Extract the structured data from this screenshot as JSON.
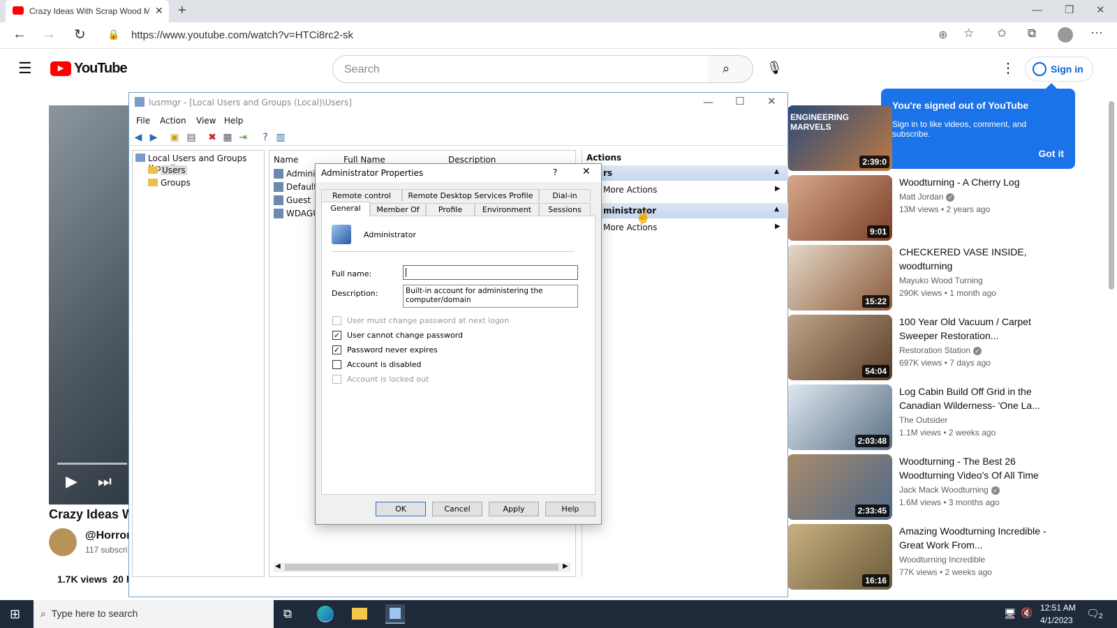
{
  "browser": {
    "tab_title": "Crazy Ideas With Scrap Wood M",
    "url": "https://www.youtube.com/watch?v=HTCi8rc2-sk"
  },
  "youtube": {
    "logo_text": "YouTube",
    "search_placeholder": "Search",
    "sign_in": "Sign in",
    "video_title_partial": "Crazy Ideas W",
    "channel_handle": "@Horror",
    "subscribers": "117 subscri",
    "views": "1.7K views",
    "age": "20 ho",
    "popup": {
      "title": "You're signed out of YouTube",
      "body": "Sign in to like videos, comment, and subscribe.",
      "button": "Got it"
    },
    "recommendations": [
      {
        "thumb_text": "ENGINEERING MARVELS",
        "duration": "2:39:0",
        "title": "",
        "channel": "",
        "meta": ""
      },
      {
        "duration": "9:01",
        "title": "Woodturning - A Cherry Log",
        "channel": "Matt Jordan",
        "verified": true,
        "meta": "13M views • 2 years ago"
      },
      {
        "duration": "15:22",
        "title": "CHECKERED VASE INSIDE, woodturning",
        "channel": "Mayuko Wood Turning",
        "verified": false,
        "meta": "290K views • 1 month ago"
      },
      {
        "duration": "54:04",
        "title": "100 Year Old Vacuum / Carpet Sweeper Restoration...",
        "channel": "Restoration Station",
        "verified": true,
        "meta": "697K views • 7 days ago"
      },
      {
        "duration": "2:03:48",
        "title": "Log Cabin Build Off Grid in the Canadian Wilderness- 'One La...",
        "channel": "The Outsider",
        "verified": false,
        "meta": "1.1M views • 2 weeks ago"
      },
      {
        "duration": "2:33:45",
        "title": "Woodturning - The Best 26 Woodturning Video's Of All Time",
        "channel": "Jack Mack Woodturning",
        "verified": true,
        "meta": "1.6M views • 3 months ago"
      },
      {
        "duration": "16:16",
        "title": "Amazing Woodturning Incredible - Great Work From...",
        "channel": "Woodturning Incredible",
        "verified": false,
        "meta": "77K views • 2 weeks ago"
      }
    ]
  },
  "lusrmgr": {
    "title": "lusrmgr - [Local Users and Groups (Local)\\Users]",
    "menu": [
      "File",
      "Action",
      "View",
      "Help"
    ],
    "tree_root": "Local Users and Groups (Local)",
    "tree_users": "Users",
    "tree_groups": "Groups",
    "columns": [
      "Name",
      "Full Name",
      "Description"
    ],
    "users": [
      "Adminis",
      "DefaultA",
      "Guest",
      "WDAGU"
    ],
    "actions_header": "Actions",
    "actions_group1": "rs",
    "more_actions": "More Actions",
    "actions_group2": "ministrator",
    "more_actions2": "More Actions"
  },
  "dialog": {
    "title": "Administrator Properties",
    "help": "?",
    "tabs_row1": [
      "Remote control",
      "Remote Desktop Services Profile",
      "Dial-in"
    ],
    "tabs_row2": [
      "General",
      "Member Of",
      "Profile",
      "Environment",
      "Sessions"
    ],
    "user": "Administrator",
    "full_name_label": "Full name:",
    "full_name_value": "",
    "description_label": "Description:",
    "description_value": "Built-in account for administering the computer/domain",
    "checkboxes": [
      {
        "label": "User must change password at next logon",
        "checked": false,
        "disabled": true
      },
      {
        "label": "User cannot change password",
        "checked": true,
        "disabled": false
      },
      {
        "label": "Password never expires",
        "checked": true,
        "disabled": false
      },
      {
        "label": "Account is disabled",
        "checked": false,
        "disabled": false
      },
      {
        "label": "Account is locked out",
        "checked": false,
        "disabled": true
      }
    ],
    "buttons": [
      "OK",
      "Cancel",
      "Apply",
      "Help"
    ]
  },
  "taskbar": {
    "search_placeholder": "Type here to search",
    "time": "12:51 AM",
    "date": "4/1/2023",
    "notifications": "2"
  }
}
